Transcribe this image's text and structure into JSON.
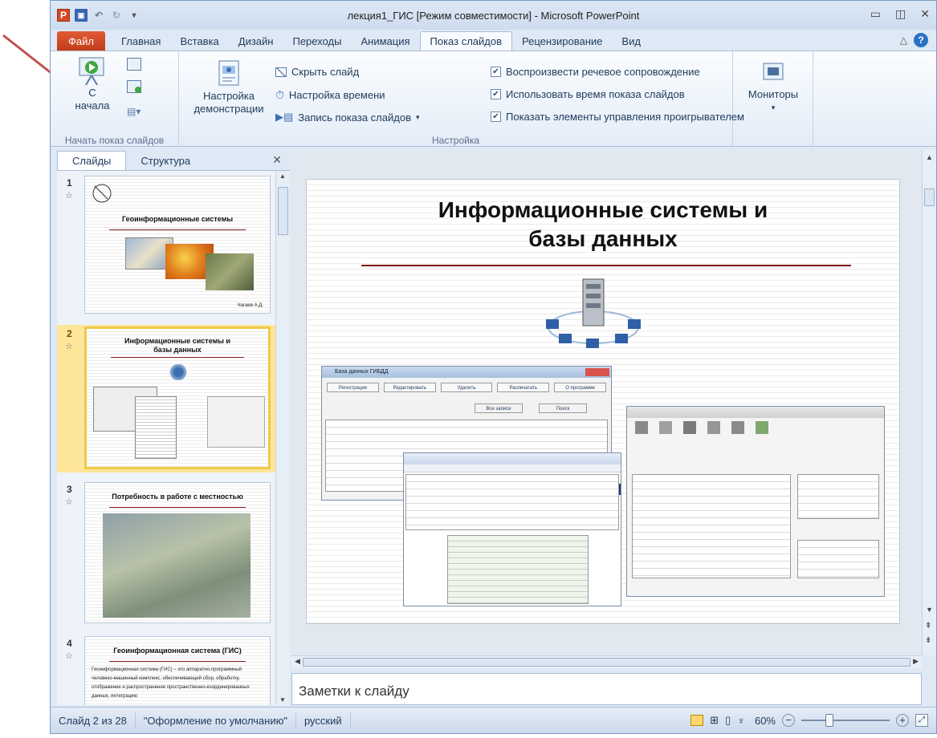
{
  "window": {
    "title": "лекция1_ГИС [Режим совместимости] - Microsoft PowerPoint"
  },
  "tabs": [
    "Файл",
    "Главная",
    "Вставка",
    "Дизайн",
    "Переходы",
    "Анимация",
    "Показ слайдов",
    "Рецензирование",
    "Вид"
  ],
  "ribbon": {
    "start_group_label": "Начать показ слайдов",
    "from_start_line1": "С",
    "from_start_line2": "начала",
    "setup_line1": "Настройка",
    "setup_line2": "демонстрации",
    "hide_slide": "Скрыть слайд",
    "rehearse_timings": "Настройка времени",
    "record_show": "Запись показа слайдов",
    "play_narrations": "Воспроизвести речевое сопровождение",
    "use_timings": "Использовать время показа слайдов",
    "show_media_controls": "Показать элементы управления проигрывателем",
    "setup_group_label": "Настройка",
    "monitors": "Мониторы"
  },
  "panel": {
    "tab_slides": "Слайды",
    "tab_outline": "Структура",
    "slides": [
      {
        "num": "1",
        "title": "Геоинформационные системы",
        "author": "Чагаев А.Д."
      },
      {
        "num": "2",
        "title_line1": "Информационные системы и",
        "title_line2": "базы данных"
      },
      {
        "num": "3",
        "title": "Потребность в работе с местностью"
      },
      {
        "num": "4",
        "title": "Геоинформационная система (ГИС)",
        "body": "Геоинформационная система (ГИС) – это аппаратно-программный человеко-машинный комплекс, обеспечивающий сбор, обработку, отображение и распространение пространственно-координированных данных, интеграцию"
      }
    ]
  },
  "slide": {
    "title_line1": "Информационные системы и",
    "title_line2": "базы данных",
    "db_window_title": "База данных ГИБДД",
    "db_buttons": [
      "Регистрация",
      "Редактировать",
      "Удалить",
      "Распечатать",
      "О программе"
    ],
    "db_all_records": "Все записи",
    "db_search": "Поиск"
  },
  "notes_placeholder": "Заметки к слайду",
  "status": {
    "slide_info": "Слайд 2 из 28",
    "theme": "\"Оформление по умолчанию\"",
    "language": "русский",
    "zoom": "60%"
  }
}
